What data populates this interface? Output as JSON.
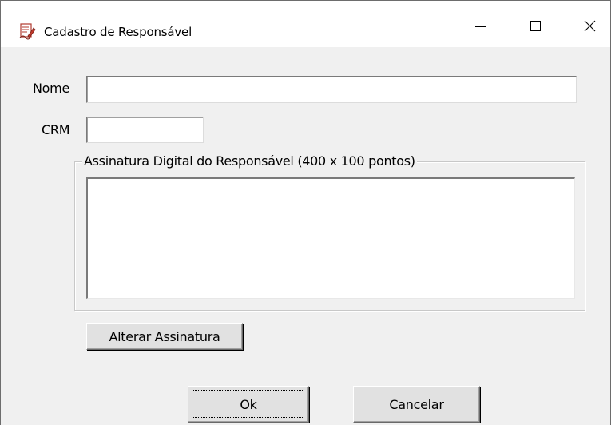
{
  "window": {
    "title": "Cadastro de Responsável",
    "app_icon": "document-pen-icon",
    "controls": {
      "minimize_icon": "minimize-icon",
      "maximize_icon": "maximize-icon",
      "close_icon": "close-icon"
    }
  },
  "form": {
    "nome": {
      "label": "Nome",
      "value": ""
    },
    "crm": {
      "label": "CRM",
      "value": ""
    },
    "signature_group": {
      "legend": "Assinatura Digital do Responsável  (400 x 100  pontos)"
    }
  },
  "buttons": {
    "alterar": "Alterar Assinatura",
    "ok": "Ok",
    "cancelar": "Cancelar"
  },
  "colors": {
    "window_bg": "#f0f0f0",
    "titlebar_bg": "#ffffff",
    "button_bg": "#e1e1e1",
    "icon_accent": "#c0392b"
  }
}
